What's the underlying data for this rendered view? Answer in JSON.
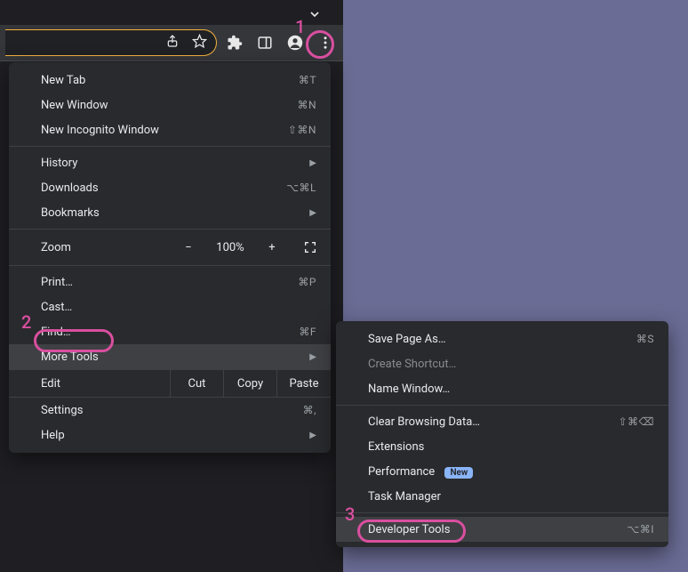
{
  "toolbar": {
    "share_icon": "share-icon",
    "star_icon": "star-icon",
    "extensions_icon": "puzzle-icon",
    "sidepanel_icon": "sidepanel-icon",
    "profile_icon": "profile-icon",
    "menu_icon": "kebab-icon"
  },
  "menu": {
    "new_tab": {
      "label": "New Tab",
      "shortcut": "⌘T"
    },
    "new_window": {
      "label": "New Window",
      "shortcut": "⌘N"
    },
    "new_incognito": {
      "label": "New Incognito Window",
      "shortcut": "⇧⌘N"
    },
    "history": {
      "label": "History"
    },
    "downloads": {
      "label": "Downloads",
      "shortcut": "⌥⌘L"
    },
    "bookmarks": {
      "label": "Bookmarks"
    },
    "zoom": {
      "label": "Zoom",
      "minus": "−",
      "value": "100%",
      "plus": "+"
    },
    "print": {
      "label": "Print…",
      "shortcut": "⌘P"
    },
    "cast": {
      "label": "Cast…"
    },
    "find": {
      "label": "Find…",
      "shortcut": "⌘F"
    },
    "more_tools": {
      "label": "More Tools"
    },
    "edit": {
      "label": "Edit",
      "cut": "Cut",
      "copy": "Copy",
      "paste": "Paste"
    },
    "settings": {
      "label": "Settings",
      "shortcut": "⌘,"
    },
    "help": {
      "label": "Help"
    }
  },
  "submenu": {
    "save_page": {
      "label": "Save Page As…",
      "shortcut": "⌘S"
    },
    "create_shortcut": {
      "label": "Create Shortcut…"
    },
    "name_window": {
      "label": "Name Window…"
    },
    "clear_browsing": {
      "label": "Clear Browsing Data…",
      "shortcut": "⇧⌘⌫"
    },
    "extensions": {
      "label": "Extensions"
    },
    "performance": {
      "label": "Performance",
      "badge": "New"
    },
    "task_manager": {
      "label": "Task Manager"
    },
    "developer_tools": {
      "label": "Developer Tools",
      "shortcut": "⌥⌘I"
    }
  },
  "callouts": {
    "one": "1",
    "two": "2",
    "three": "3"
  }
}
